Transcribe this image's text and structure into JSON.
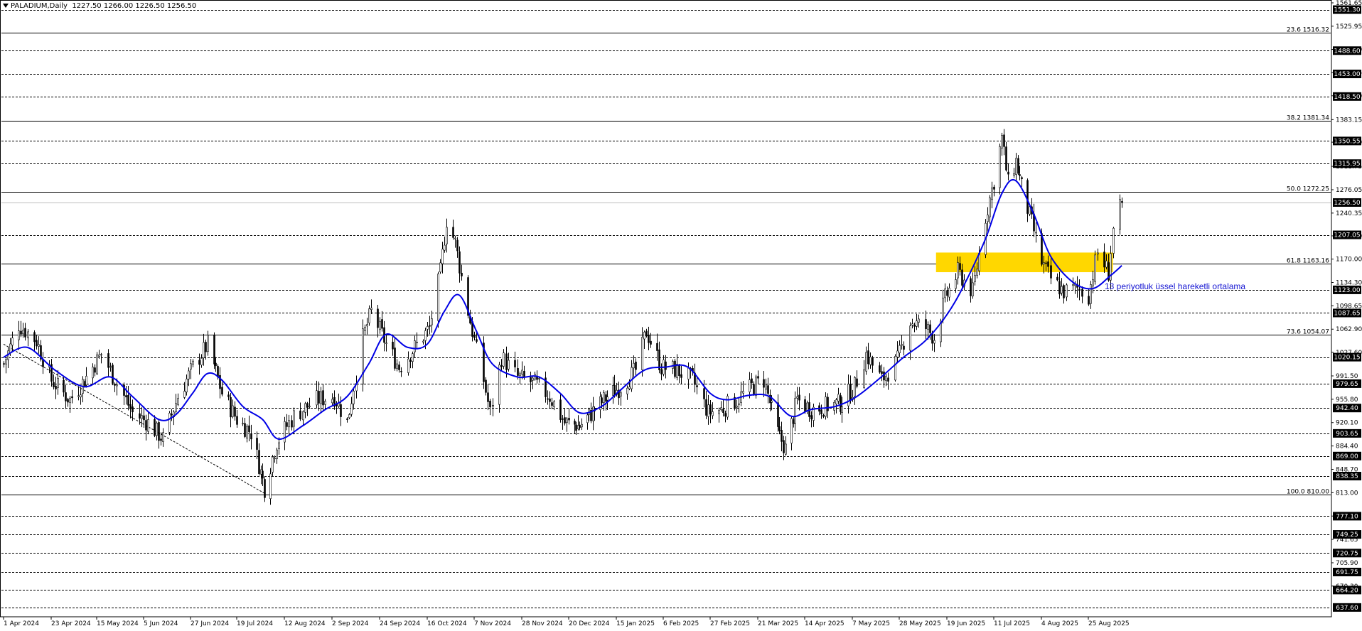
{
  "header": {
    "symbol_label": "PALADIUM,Daily",
    "ohlc_label": "1227.50 1266.00 1226.50 1256.50"
  },
  "annotation_text": "13 periyotluk üssel hareketli ortalama",
  "colors": {
    "background": "#ffffff",
    "ema": "#0000e6",
    "zone": "#ffd700",
    "candles": "#000000",
    "label_bg": "#000000",
    "label_text": "#ffffff"
  },
  "chart_data": {
    "type": "candlestick",
    "title": "PALADIUM,Daily",
    "ylim": [
      637.6,
      1561.65
    ],
    "grid": false,
    "y_ticks": [
      "1561.65",
      "1525.95",
      "1490.50",
      "1455.05",
      "1419.60",
      "1383.15",
      "1348.70",
      "1311.75",
      "1276.05",
      "1240.35",
      "1205.50",
      "1170.00",
      "1134.30",
      "1098.65",
      "1062.90",
      "1027.60",
      "991.50",
      "955.80",
      "920.10",
      "884.40",
      "848.70",
      "813.00",
      "777.30",
      "741.65",
      "705.90",
      "670.30"
    ],
    "x_ticks": [
      "1 Apr 2024",
      "23 Apr 2024",
      "15 May 2024",
      "5 Jun 2024",
      "27 Jun 2024",
      "19 Jul 2024",
      "12 Aug 2024",
      "2 Sep 2024",
      "24 Sep 2024",
      "16 Oct 2024",
      "7 Nov 2024",
      "28 Nov 2024",
      "20 Dec 2024",
      "15 Jan 2025",
      "6 Feb 2025",
      "27 Feb 2025",
      "21 Mar 2025",
      "14 Apr 2025",
      "7 May 2025",
      "28 May 2025",
      "19 Jun 2025",
      "11 Jul 2025",
      "4 Aug 2025",
      "25 Aug 2025"
    ],
    "horizontal_levels": [
      {
        "price": 1551.3,
        "label": "1551.30",
        "style": "dash",
        "boxed": true
      },
      {
        "price": 1488.6,
        "label": "1488.60",
        "style": "dash",
        "boxed": true
      },
      {
        "price": 1453.0,
        "label": "1453.00",
        "style": "dash",
        "boxed": true
      },
      {
        "price": 1418.5,
        "label": "1418.50",
        "style": "dash",
        "boxed": true
      },
      {
        "price": 1350.55,
        "label": "1350.55",
        "style": "dash",
        "boxed": true
      },
      {
        "price": 1315.95,
        "label": "1315.95",
        "style": "dash",
        "boxed": true
      },
      {
        "price": 1256.5,
        "label": "1256.50",
        "style": "current",
        "boxed": true
      },
      {
        "price": 1207.05,
        "label": "1207.05",
        "style": "dash",
        "boxed": true
      },
      {
        "price": 1123.0,
        "label": "1123.00",
        "style": "dash",
        "boxed": true
      },
      {
        "price": 1087.65,
        "label": "1087.65",
        "style": "dash",
        "boxed": true
      },
      {
        "price": 1020.15,
        "label": "1020.15",
        "style": "dash",
        "boxed": true
      },
      {
        "price": 979.65,
        "label": "979.65",
        "style": "dash",
        "boxed": true
      },
      {
        "price": 942.4,
        "label": "942.40",
        "style": "dash",
        "boxed": true
      },
      {
        "price": 903.65,
        "label": "903.65",
        "style": "dash",
        "boxed": true
      },
      {
        "price": 869.0,
        "label": "869.00",
        "style": "dash",
        "boxed": true
      },
      {
        "price": 838.35,
        "label": "838.35",
        "style": "dash",
        "boxed": true
      },
      {
        "price": 777.1,
        "label": "777.10",
        "style": "dash",
        "boxed": true
      },
      {
        "price": 749.25,
        "label": "749.25",
        "style": "dash",
        "boxed": true
      },
      {
        "price": 720.75,
        "label": "720.75",
        "style": "dash",
        "boxed": true
      },
      {
        "price": 691.75,
        "label": "691.75",
        "style": "dash",
        "boxed": true
      },
      {
        "price": 664.2,
        "label": "664.20",
        "style": "dash",
        "boxed": true
      },
      {
        "price": 637.6,
        "label": "637.60",
        "style": "dash",
        "boxed": true
      }
    ],
    "fibonacci_levels": [
      {
        "price": 1516.32,
        "label": "23.6 1516.32"
      },
      {
        "price": 1381.34,
        "label": "38.2 1381.34"
      },
      {
        "price": 1272.25,
        "label": "50.0 1272.25"
      },
      {
        "price": 1163.16,
        "label": "61.8 1163.16"
      },
      {
        "price": 1054.07,
        "label": "73.6 1054.07"
      },
      {
        "price": 810.0,
        "label": "100.0 810.00"
      }
    ],
    "support_zone": {
      "from": 1150,
      "to": 1180,
      "start_date": "14 Jun 2025",
      "end_date": "5 Sep 2025"
    },
    "trendline": {
      "from": {
        "date": "1 Apr 2024",
        "price": 1040
      },
      "to": {
        "date": "2 Aug 2024",
        "price": 812
      }
    },
    "price_keypoints": [
      {
        "date": "1 Apr 2024",
        "price": 1010
      },
      {
        "date": "8 Apr 2024",
        "price": 1070
      },
      {
        "date": "16 Apr 2024",
        "price": 1045
      },
      {
        "date": "23 Apr 2024",
        "price": 985
      },
      {
        "date": "2 May 2024",
        "price": 955
      },
      {
        "date": "10 May 2024",
        "price": 990
      },
      {
        "date": "17 May 2024",
        "price": 1025
      },
      {
        "date": "24 May 2024",
        "price": 980
      },
      {
        "date": "31 May 2024",
        "price": 935
      },
      {
        "date": "7 Jun 2024",
        "price": 920
      },
      {
        "date": "14 Jun 2024",
        "price": 895
      },
      {
        "date": "21 Jun 2024",
        "price": 960
      },
      {
        "date": "28 Jun 2024",
        "price": 1005
      },
      {
        "date": "5 Jul 2024",
        "price": 1040
      },
      {
        "date": "12 Jul 2024",
        "price": 965
      },
      {
        "date": "19 Jul 2024",
        "price": 925
      },
      {
        "date": "26 Jul 2024",
        "price": 905
      },
      {
        "date": "2 Aug 2024",
        "price": 820
      },
      {
        "date": "8 Aug 2024",
        "price": 890
      },
      {
        "date": "16 Aug 2024",
        "price": 930
      },
      {
        "date": "26 Aug 2024",
        "price": 955
      },
      {
        "date": "3 Sep 2024",
        "price": 960
      },
      {
        "date": "9 Sep 2024",
        "price": 920
      },
      {
        "date": "16 Sep 2024",
        "price": 1050
      },
      {
        "date": "20 Sep 2024",
        "price": 1090
      },
      {
        "date": "27 Sep 2024",
        "price": 1040
      },
      {
        "date": "3 Oct 2024",
        "price": 1005
      },
      {
        "date": "10 Oct 2024",
        "price": 1035
      },
      {
        "date": "17 Oct 2024",
        "price": 1065
      },
      {
        "date": "22 Oct 2024",
        "price": 1150
      },
      {
        "date": "25 Oct 2024",
        "price": 1230
      },
      {
        "date": "29 Oct 2024",
        "price": 1195
      },
      {
        "date": "4 Nov 2024",
        "price": 1090
      },
      {
        "date": "11 Nov 2024",
        "price": 985
      },
      {
        "date": "14 Nov 2024",
        "price": 935
      },
      {
        "date": "19 Nov 2024",
        "price": 1020
      },
      {
        "date": "26 Nov 2024",
        "price": 990
      },
      {
        "date": "4 Dec 2024",
        "price": 980
      },
      {
        "date": "11 Dec 2024",
        "price": 960
      },
      {
        "date": "18 Dec 2024",
        "price": 920
      },
      {
        "date": "26 Dec 2024",
        "price": 915
      },
      {
        "date": "3 Jan 2025",
        "price": 940
      },
      {
        "date": "10 Jan 2025",
        "price": 960
      },
      {
        "date": "17 Jan 2025",
        "price": 975
      },
      {
        "date": "24 Jan 2025",
        "price": 1000
      },
      {
        "date": "29 Jan 2025",
        "price": 1060
      },
      {
        "date": "5 Feb 2025",
        "price": 1005
      },
      {
        "date": "12 Feb 2025",
        "price": 1000
      },
      {
        "date": "19 Feb 2025",
        "price": 985
      },
      {
        "date": "26 Feb 2025",
        "price": 935
      },
      {
        "date": "4 Mar 2025",
        "price": 940
      },
      {
        "date": "11 Mar 2025",
        "price": 955
      },
      {
        "date": "18 Mar 2025",
        "price": 975
      },
      {
        "date": "24 Mar 2025",
        "price": 985
      },
      {
        "date": "31 Mar 2025",
        "price": 905
      },
      {
        "date": "4 Apr 2025",
        "price": 880
      },
      {
        "date": "10 Apr 2025",
        "price": 955
      },
      {
        "date": "17 Apr 2025",
        "price": 940
      },
      {
        "date": "24 Apr 2025",
        "price": 945
      },
      {
        "date": "1 May 2025",
        "price": 950
      },
      {
        "date": "8 May 2025",
        "price": 975
      },
      {
        "date": "13 May 2025",
        "price": 1025
      },
      {
        "date": "20 May 2025",
        "price": 985
      },
      {
        "date": "27 May 2025",
        "price": 1015
      },
      {
        "date": "2 Jun 2025",
        "price": 1075
      },
      {
        "date": "9 Jun 2025",
        "price": 1065
      },
      {
        "date": "13 Jun 2025",
        "price": 1050
      },
      {
        "date": "18 Jun 2025",
        "price": 1110
      },
      {
        "date": "24 Jun 2025",
        "price": 1150
      },
      {
        "date": "1 Jul 2025",
        "price": 1120
      },
      {
        "date": "7 Jul 2025",
        "price": 1235
      },
      {
        "date": "11 Jul 2025",
        "price": 1290
      },
      {
        "date": "15 Jul 2025",
        "price": 1355
      },
      {
        "date": "18 Jul 2025",
        "price": 1285
      },
      {
        "date": "22 Jul 2025",
        "price": 1320
      },
      {
        "date": "25 Jul 2025",
        "price": 1280
      },
      {
        "date": "30 Jul 2025",
        "price": 1225
      },
      {
        "date": "4 Aug 2025",
        "price": 1165
      },
      {
        "date": "8 Aug 2025",
        "price": 1140
      },
      {
        "date": "14 Aug 2025",
        "price": 1120
      },
      {
        "date": "20 Aug 2025",
        "price": 1125
      },
      {
        "date": "25 Aug 2025",
        "price": 1115
      },
      {
        "date": "29 Aug 2025",
        "price": 1180
      },
      {
        "date": "3 Sep 2025",
        "price": 1150
      },
      {
        "date": "5 Sep 2025",
        "price": 1215
      },
      {
        "date": "9 Sep 2025",
        "price": 1256.5
      }
    ],
    "ema_keypoints": [
      {
        "date": "1 Apr 2024",
        "price": 1020
      },
      {
        "date": "12 Apr 2024",
        "price": 1035
      },
      {
        "date": "25 Apr 2024",
        "price": 1000
      },
      {
        "date": "9 May 2024",
        "price": 975
      },
      {
        "date": "21 May 2024",
        "price": 990
      },
      {
        "date": "31 May 2024",
        "price": 960
      },
      {
        "date": "12 Jun 2024",
        "price": 925
      },
      {
        "date": "20 Jun 2024",
        "price": 932
      },
      {
        "date": "28 Jun 2024",
        "price": 965
      },
      {
        "date": "5 Jul 2024",
        "price": 995
      },
      {
        "date": "12 Jul 2024",
        "price": 985
      },
      {
        "date": "22 Jul 2024",
        "price": 945
      },
      {
        "date": "1 Aug 2024",
        "price": 925
      },
      {
        "date": "9 Aug 2024",
        "price": 895
      },
      {
        "date": "20 Aug 2024",
        "price": 915
      },
      {
        "date": "30 Aug 2024",
        "price": 940
      },
      {
        "date": "9 Sep 2024",
        "price": 960
      },
      {
        "date": "19 Sep 2024",
        "price": 1010
      },
      {
        "date": "27 Sep 2024",
        "price": 1055
      },
      {
        "date": "7 Oct 2024",
        "price": 1035
      },
      {
        "date": "16 Oct 2024",
        "price": 1040
      },
      {
        "date": "24 Oct 2024",
        "price": 1090
      },
      {
        "date": "31 Oct 2024",
        "price": 1115
      },
      {
        "date": "8 Nov 2024",
        "price": 1060
      },
      {
        "date": "15 Nov 2024",
        "price": 1010
      },
      {
        "date": "26 Nov 2024",
        "price": 990
      },
      {
        "date": "6 Dec 2024",
        "price": 990
      },
      {
        "date": "16 Dec 2024",
        "price": 965
      },
      {
        "date": "26 Dec 2024",
        "price": 935
      },
      {
        "date": "7 Jan 2025",
        "price": 945
      },
      {
        "date": "17 Jan 2025",
        "price": 970
      },
      {
        "date": "28 Jan 2025",
        "price": 1000
      },
      {
        "date": "7 Feb 2025",
        "price": 1005
      },
      {
        "date": "17 Feb 2025",
        "price": 1005
      },
      {
        "date": "27 Feb 2025",
        "price": 965
      },
      {
        "date": "7 Mar 2025",
        "price": 955
      },
      {
        "date": "17 Mar 2025",
        "price": 962
      },
      {
        "date": "27 Mar 2025",
        "price": 960
      },
      {
        "date": "7 Apr 2025",
        "price": 930
      },
      {
        "date": "17 Apr 2025",
        "price": 940
      },
      {
        "date": "29 Apr 2025",
        "price": 945
      },
      {
        "date": "9 May 2025",
        "price": 960
      },
      {
        "date": "20 May 2025",
        "price": 990
      },
      {
        "date": "30 May 2025",
        "price": 1020
      },
      {
        "date": "9 Jun 2025",
        "price": 1045
      },
      {
        "date": "19 Jun 2025",
        "price": 1085
      },
      {
        "date": "27 Jun 2025",
        "price": 1130
      },
      {
        "date": "7 Jul 2025",
        "price": 1200
      },
      {
        "date": "15 Jul 2025",
        "price": 1270
      },
      {
        "date": "22 Jul 2025",
        "price": 1290
      },
      {
        "date": "31 Jul 2025",
        "price": 1240
      },
      {
        "date": "8 Aug 2025",
        "price": 1175
      },
      {
        "date": "18 Aug 2025",
        "price": 1135
      },
      {
        "date": "27 Aug 2025",
        "price": 1125
      },
      {
        "date": "4 Sep 2025",
        "price": 1145
      },
      {
        "date": "9 Sep 2025",
        "price": 1160
      }
    ]
  }
}
